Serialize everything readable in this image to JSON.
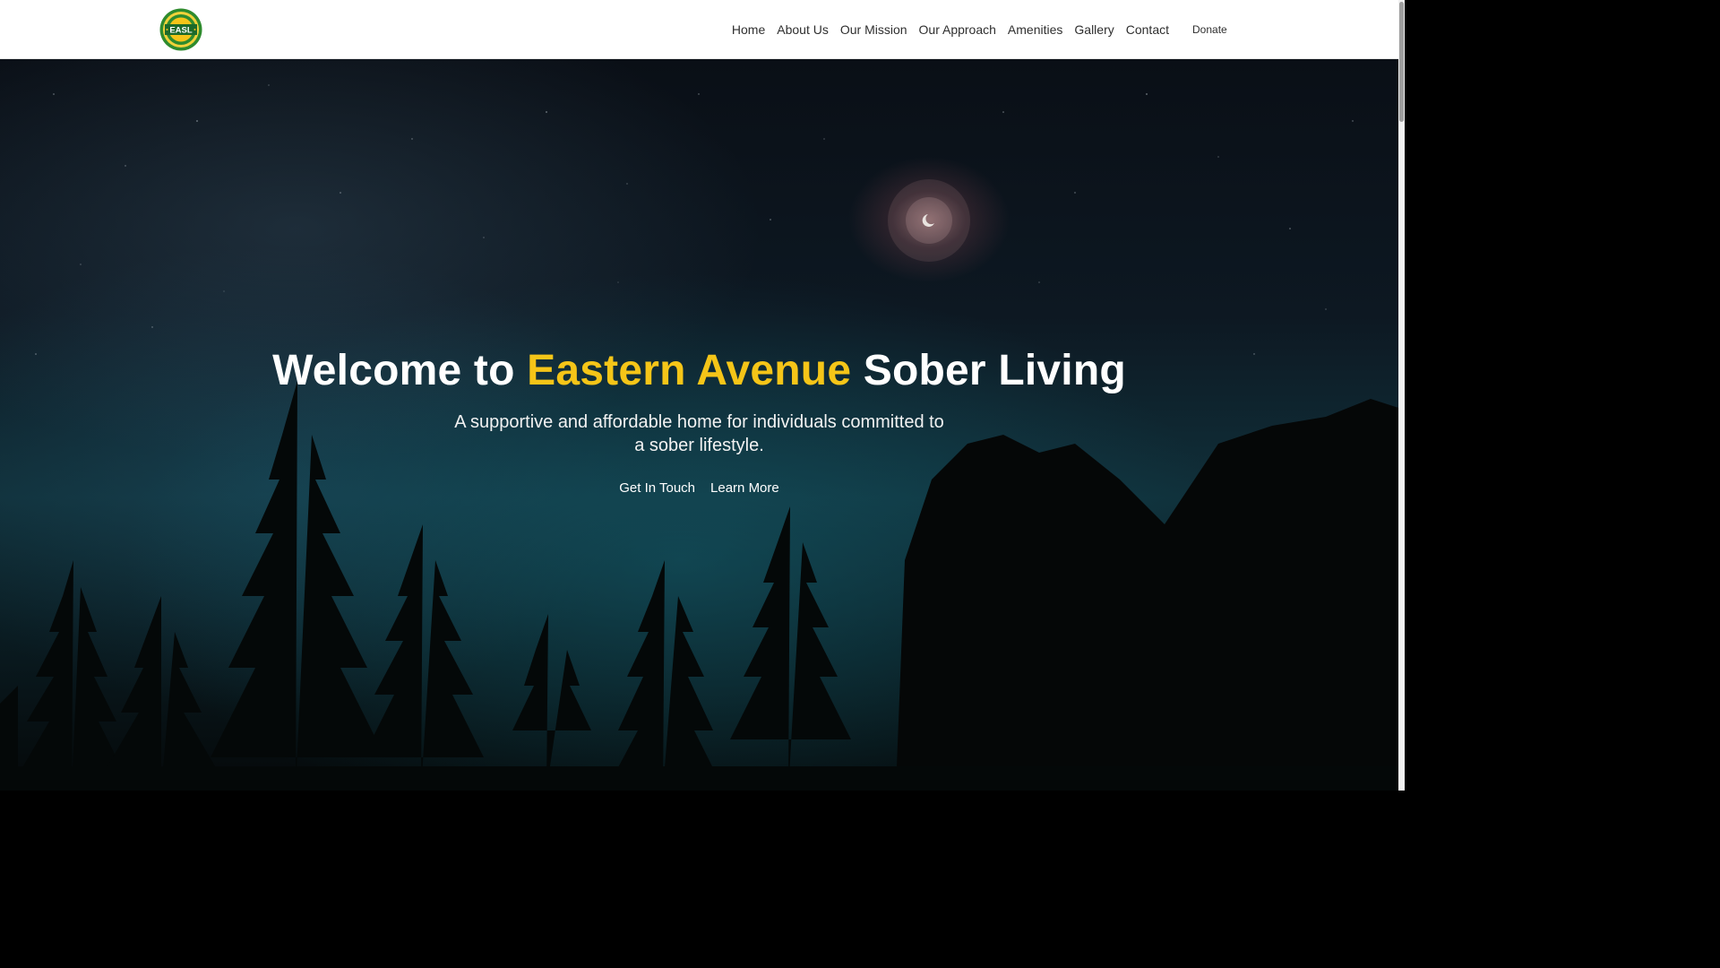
{
  "brand": {
    "logo_text": "EASL",
    "logo_colors": {
      "ring": "#2e8b2e",
      "center": "#f5c518",
      "band": "#1d6a2a"
    }
  },
  "nav": {
    "items": [
      "Home",
      "About Us",
      "Our Mission",
      "Our Approach",
      "Amenities",
      "Gallery",
      "Contact"
    ],
    "donate_label": "Donate"
  },
  "hero": {
    "title_before": "Welcome to ",
    "title_accent": "Eastern Avenue",
    "title_after": " Sober Living",
    "subtitle": "A supportive and affordable home for individuals committed to a sober lifestyle.",
    "primary_cta": "Get In Touch",
    "secondary_cta": "Learn More",
    "background": "night-sky-forest-image"
  },
  "colors": {
    "accent": "#f5c518",
    "nav_text": "#2f2f2f",
    "hero_text": "#ffffff"
  }
}
